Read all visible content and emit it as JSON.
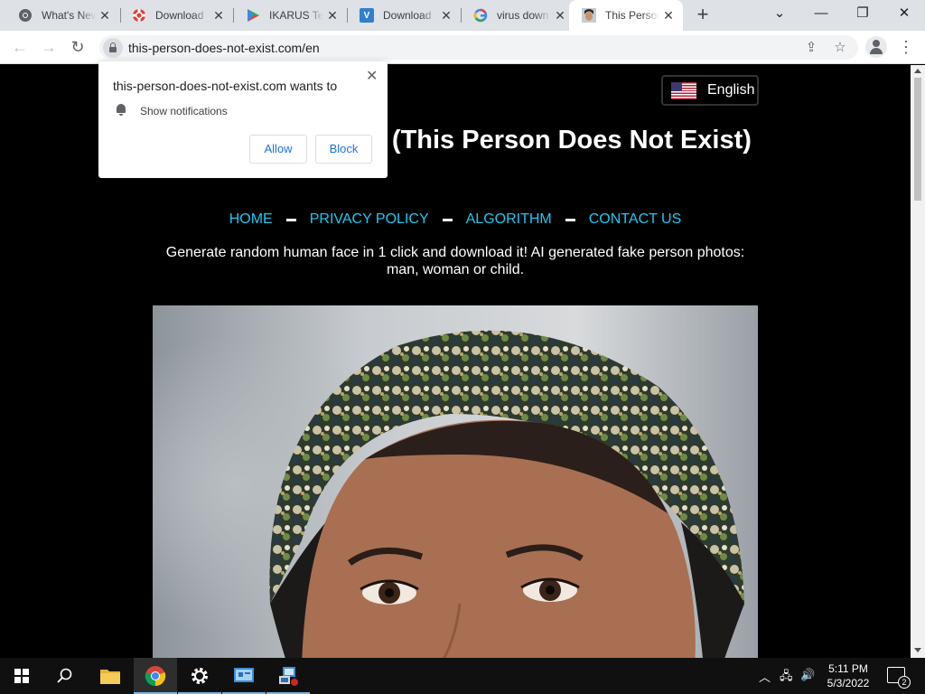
{
  "browser": {
    "tabs": [
      {
        "title": "What's New",
        "favicon": "chrome-icon"
      },
      {
        "title": "Download",
        "favicon": "lifebuoy-icon"
      },
      {
        "title": "IKARUS Te",
        "favicon": "play-icon"
      },
      {
        "title": "Download",
        "favicon": "ve-icon"
      },
      {
        "title": "virus down",
        "favicon": "google-icon"
      },
      {
        "title": "This Person",
        "favicon": "portrait-icon",
        "active": true
      }
    ],
    "url": "this-person-does-not-exist.com/en"
  },
  "popup": {
    "title": "this-person-does-not-exist.com wants to",
    "permission": "Show notifications",
    "allow_label": "Allow",
    "block_label": "Block"
  },
  "site": {
    "language_label": "English",
    "title": "AI Face Generator (This Person Does Not Exist)",
    "nav": {
      "home": "HOME",
      "privacy": "PRIVACY POLICY",
      "algorithm": "ALGORITHM",
      "contact": "CONTACT US"
    },
    "description": "Generate random human face in 1 click and download it! AI generated fake person photos: man, woman or child.",
    "colors": {
      "link": "#21c8f0",
      "background": "#000000"
    }
  },
  "taskbar": {
    "time": "5:11 PM",
    "date": "5/3/2022",
    "notification_count": "2"
  }
}
